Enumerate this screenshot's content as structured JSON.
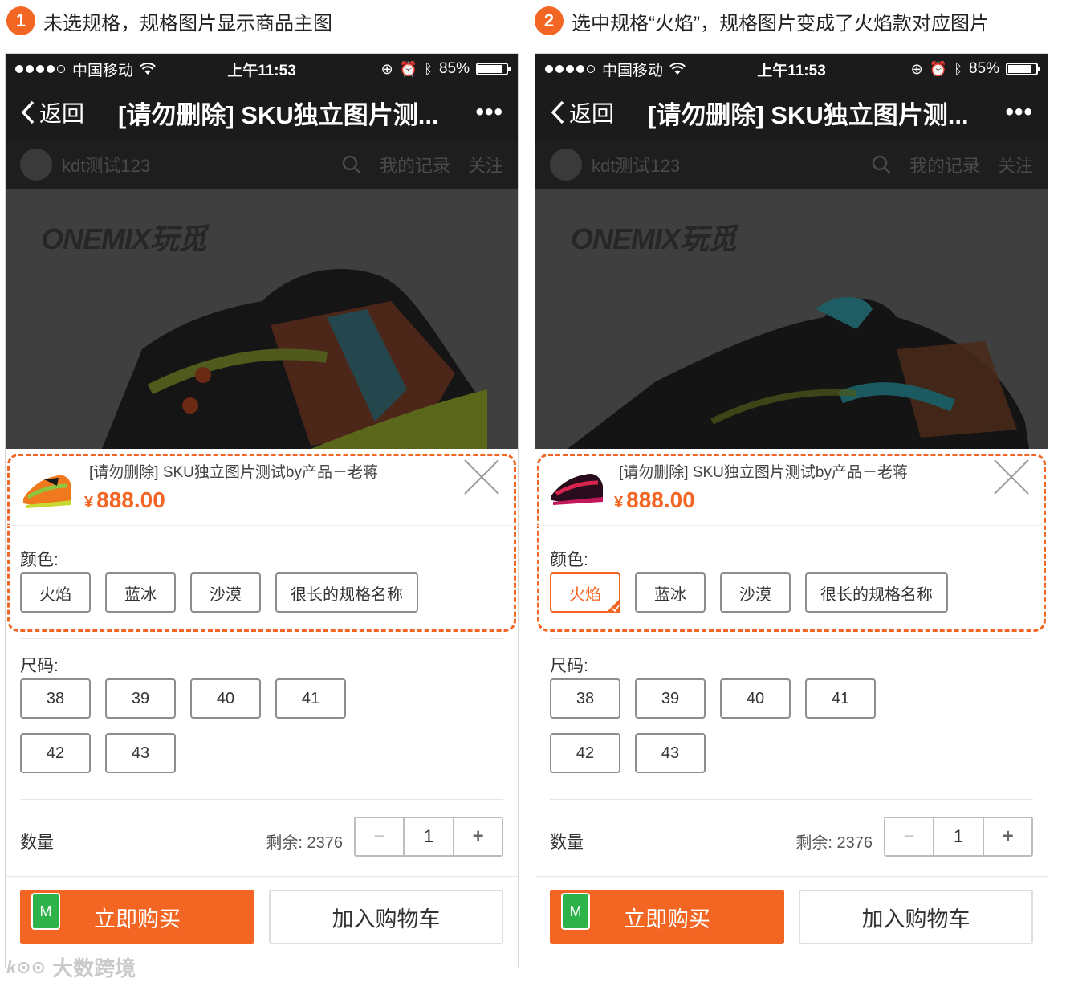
{
  "panels": [
    {
      "step": "1",
      "caption": "未选规格，规格图片显示商品主图",
      "status": {
        "carrier": "中国移动",
        "time": "上午11:53",
        "battery": "85%",
        "battery_level": 0.85
      },
      "nav": {
        "back_label": "返回",
        "title": "[请勿删除] SKU独立图片测...",
        "more_label": "•••"
      },
      "shop": {
        "name": "kdt测试123",
        "records": "我的记录",
        "follow": "关注"
      },
      "hero": {
        "brand": "ONEMIX玩觅",
        "shoe": "main"
      },
      "sku": {
        "title": "[请勿删除] SKU独立图片测试by产品－老蒋",
        "currency": "¥",
        "price": "888.00",
        "thumb": "multicolor"
      },
      "color_group": {
        "label": "颜色:",
        "options": [
          "火焰",
          "蓝冰",
          "沙漠",
          "很长的规格名称"
        ],
        "selected": null
      },
      "size_group": {
        "label": "尺码:",
        "options": [
          "38",
          "39",
          "40",
          "41",
          "42",
          "43"
        ]
      },
      "quantity": {
        "label": "数量",
        "stock": "剩余: 2376",
        "minus": "−",
        "value": "1",
        "plus": "+"
      },
      "actions": {
        "buy_label": "立即购买",
        "badge": "M",
        "cart_label": "加入购物车"
      }
    },
    {
      "step": "2",
      "caption": "选中规格“火焰”，规格图片变成了火焰款对应图片",
      "status": {
        "carrier": "中国移动",
        "time": "上午11:53",
        "battery": "85%",
        "battery_level": 0.85
      },
      "nav": {
        "back_label": "返回",
        "title": "[请勿删除] SKU独立图片测...",
        "more_label": "•••"
      },
      "shop": {
        "name": "kdt测试123",
        "records": "我的记录",
        "follow": "关注"
      },
      "hero": {
        "brand": "ONEMIX玩觅",
        "shoe": "flame"
      },
      "sku": {
        "title": "[请勿删除] SKU独立图片测试by产品－老蒋",
        "currency": "¥",
        "price": "888.00",
        "thumb": "flame"
      },
      "color_group": {
        "label": "颜色:",
        "options": [
          "火焰",
          "蓝冰",
          "沙漠",
          "很长的规格名称"
        ],
        "selected": "火焰"
      },
      "size_group": {
        "label": "尺码:",
        "options": [
          "38",
          "39",
          "40",
          "41",
          "42",
          "43"
        ]
      },
      "quantity": {
        "label": "数量",
        "stock": "剩余: 2376",
        "minus": "−",
        "value": "1",
        "plus": "+"
      },
      "actions": {
        "buy_label": "立即购买",
        "badge": "M",
        "cart_label": "加入购物车"
      }
    }
  ],
  "watermark": "大数跨境",
  "colors": {
    "accent": "#f26522",
    "dark_bar": "#1b1b1b",
    "badge_green": "#2db34a"
  }
}
